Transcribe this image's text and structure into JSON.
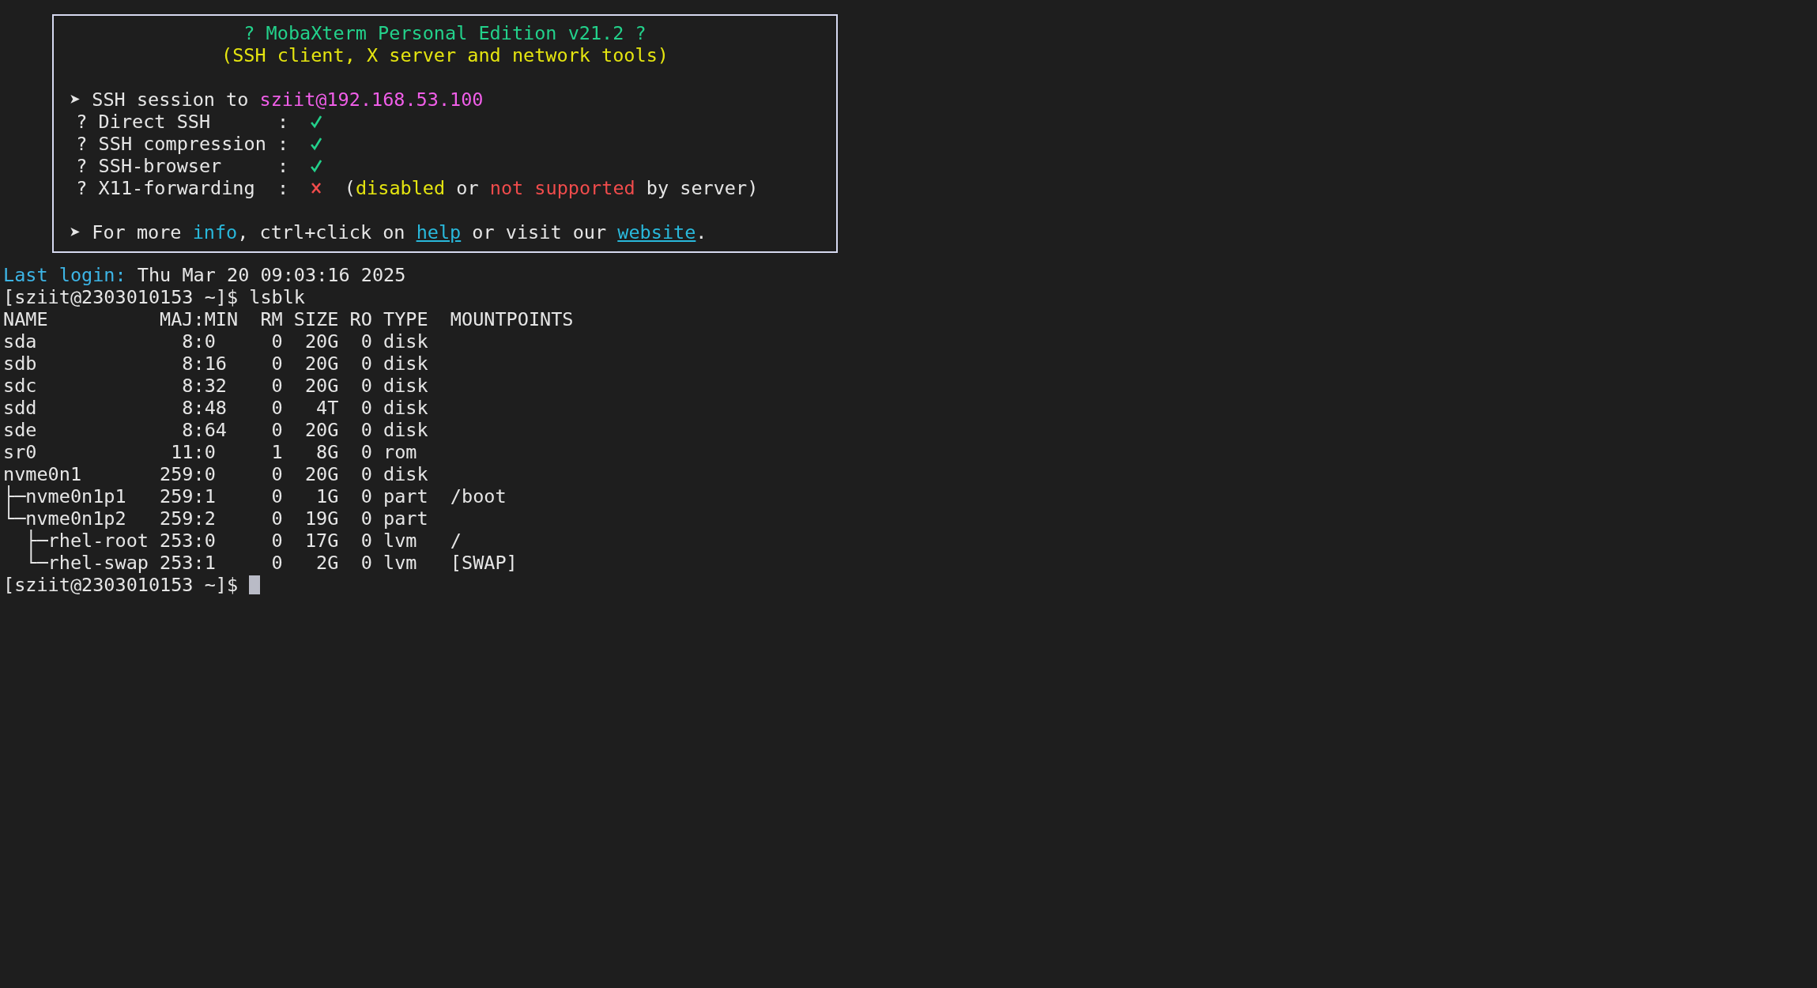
{
  "banner": {
    "title": "? MobaXterm Personal Edition v21.2 ?",
    "subtitle": "(SSH client, X server and network tools)",
    "session": {
      "bullet": "➤",
      "label": "SSH session to",
      "host": "sziit@192.168.53.100"
    },
    "features": [
      {
        "marker": "?",
        "label": "Direct SSH",
        "separator": ":",
        "enabled": true
      },
      {
        "marker": "?",
        "label": "SSH compression",
        "separator": ":",
        "enabled": true
      },
      {
        "marker": "?",
        "label": "SSH-browser",
        "separator": ":",
        "enabled": true
      },
      {
        "marker": "?",
        "label": "X11-forwarding",
        "separator": ":",
        "enabled": false,
        "note": [
          {
            "text": "(",
            "kind": "plain"
          },
          {
            "text": "disabled",
            "kind": "warn"
          },
          {
            "text": " or ",
            "kind": "plain"
          },
          {
            "text": "not supported",
            "kind": "error"
          },
          {
            "text": " by server)",
            "kind": "plain"
          }
        ]
      }
    ],
    "info": {
      "bullet": "➤",
      "parts": [
        {
          "text": "For more ",
          "kind": "plain"
        },
        {
          "text": "info",
          "kind": "accent"
        },
        {
          "text": ", ctrl+click on ",
          "kind": "plain"
        },
        {
          "text": "help",
          "kind": "link"
        },
        {
          "text": " or visit our ",
          "kind": "plain"
        },
        {
          "text": "website",
          "kind": "link"
        },
        {
          "text": ".",
          "kind": "plain"
        }
      ]
    }
  },
  "last_login": {
    "label": "Last login:",
    "value": "Thu Mar 20 09:03:16 2025"
  },
  "command_prompt": {
    "prompt": "[sziit@2303010153 ~]$",
    "command": "lsblk"
  },
  "table": {
    "columns": [
      "NAME",
      "MAJ:MIN",
      "RM",
      "SIZE",
      "RO",
      "TYPE",
      "MOUNTPOINTS"
    ],
    "rows": [
      [
        "sda",
        "8:0",
        "0",
        "20G",
        "0",
        "disk"
      ],
      [
        "sdb",
        "8:16",
        "0",
        "20G",
        "0",
        "disk"
      ],
      [
        "sdc",
        "8:32",
        "0",
        "20G",
        "0",
        "disk"
      ],
      [
        "sdd",
        "8:48",
        "0",
        "4T",
        "0",
        "disk"
      ],
      [
        "sde",
        "8:64",
        "0",
        "20G",
        "0",
        "disk"
      ],
      [
        "sr0",
        "11:0",
        "1",
        "8G",
        "0",
        "rom"
      ],
      [
        "nvme0n1",
        "259:0",
        "0",
        "20G",
        "0",
        "disk"
      ],
      [
        "├─nvme0n1p1",
        "259:1",
        "0",
        "1G",
        "0",
        "part",
        "/boot"
      ],
      [
        "└─nvme0n1p2",
        "259:2",
        "0",
        "19G",
        "0",
        "part"
      ],
      [
        "  ├─rhel-root",
        "253:0",
        "0",
        "17G",
        "0",
        "lvm",
        "/"
      ],
      [
        "  └─rhel-swap",
        "253:1",
        "0",
        "2G",
        "0",
        "lvm",
        "[SWAP]"
      ]
    ]
  },
  "final_prompt": {
    "prompt": "[sziit@2303010153 ~]$"
  }
}
